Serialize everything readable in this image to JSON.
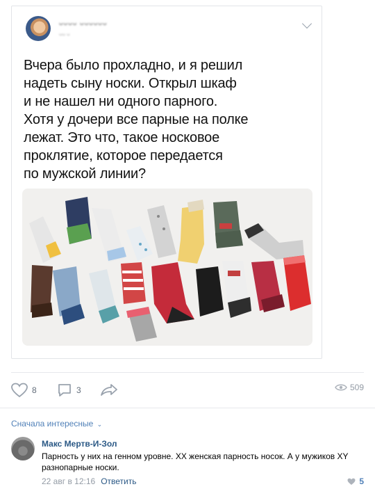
{
  "post": {
    "author_name": "ᴗᴗᴗᴗ ᴗᴗᴗᴗᴗᴗ",
    "author_sub": "ᴗᴗ ᴗ",
    "text": "Вчера было прохладно, и я решил\nнадеть сыну носки. Открыл шкаф\nи не нашел ни одного парного.\nХотя у дочери все парные на полке\nлежат. Это что, такое носковое\nпроклятие, которое передается\nпо мужской линии?",
    "photo_icon": "socks-photo",
    "likes": "8",
    "comments": "3",
    "views": "509"
  },
  "comments": {
    "sort_label": "Сначала интересные",
    "items": [
      {
        "author": "Макс Мертв-И-Зол",
        "text": "Парность у них на генном уровне. XX женская парность носок. А у мужиков XY разнопарные носки.",
        "date": "22 авг в 12:16",
        "reply_label": "Ответить",
        "likes": "5"
      }
    ]
  },
  "colors": {
    "accent": "#5181b8",
    "link": "#2a5885",
    "muted": "#939ba5"
  }
}
